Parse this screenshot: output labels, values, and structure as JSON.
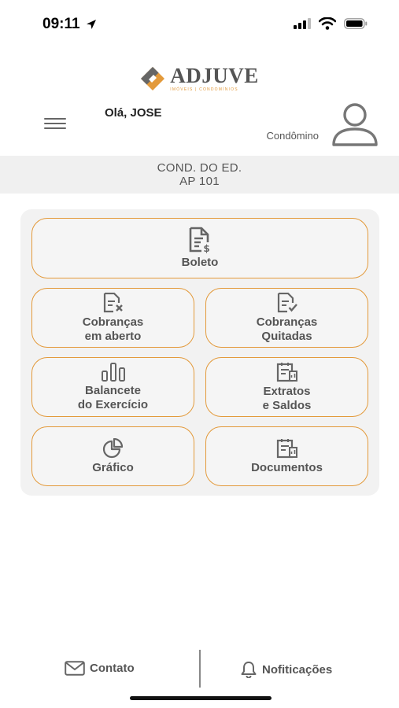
{
  "status_bar": {
    "time": "09:11"
  },
  "logo": {
    "name": "ADJUVE",
    "tagline": "IMÓVEIS | CONDOMÍNIOS"
  },
  "header": {
    "greeting": "Olá, JOSE",
    "role": "Condômino"
  },
  "unit": {
    "line1": "COND. DO ED.",
    "line2": "AP 101"
  },
  "tiles": [
    {
      "label": "Boleto",
      "icon": "invoice-dollar-icon"
    },
    {
      "label": "Cobranças\nem aberto",
      "icon": "invoice-x-icon"
    },
    {
      "label": "Cobranças\nQuitadas",
      "icon": "invoice-check-icon"
    },
    {
      "label": "Balancete\ndo Exercício",
      "icon": "bar-chart-icon"
    },
    {
      "label": "Extratos\ne Saldos",
      "icon": "statement-icon"
    },
    {
      "label": "Gráfico",
      "icon": "pie-chart-icon"
    },
    {
      "label": "Documentos",
      "icon": "documents-icon"
    }
  ],
  "bottom_bar": {
    "contact": "Contato",
    "notifications": "Nofiticações"
  },
  "colors": {
    "accent": "#e39a3b",
    "text": "#555555",
    "band": "#f0f0f0"
  }
}
